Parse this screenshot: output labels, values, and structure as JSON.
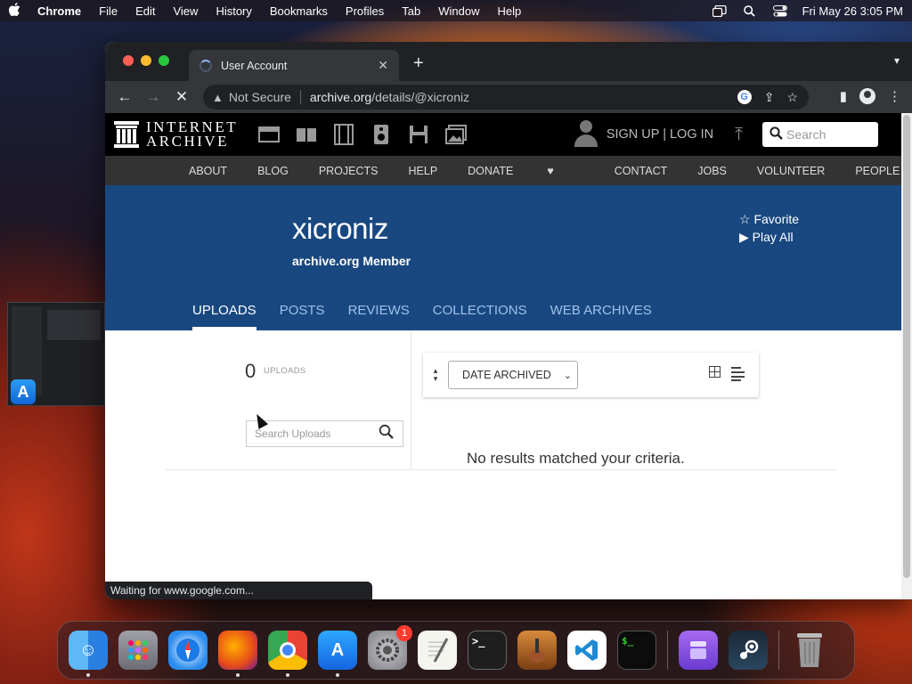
{
  "menubar": {
    "app": "Chrome",
    "items": [
      "File",
      "Edit",
      "View",
      "History",
      "Bookmarks",
      "Profiles",
      "Tab",
      "Window",
      "Help"
    ],
    "datetime": "Fri May 26  3:05 PM"
  },
  "browser": {
    "tab_title": "User Account",
    "security_label": "Not Secure",
    "url_host": "archive.org",
    "url_path": "/details/@xicroniz",
    "status_text": "Waiting for www.google.com..."
  },
  "ia": {
    "logo_line1": "INTERNET",
    "logo_line2": "ARCHIVE",
    "signin": "SIGN UP | LOG IN",
    "search_placeholder": "Search",
    "nav": [
      "ABOUT",
      "BLOG",
      "PROJECTS",
      "HELP",
      "DONATE",
      "CONTACT",
      "JOBS",
      "VOLUNTEER",
      "PEOPLE"
    ]
  },
  "profile": {
    "username": "xicroniz",
    "member_label": "archive.org Member",
    "favorite_label": "Favorite",
    "playall_label": "Play All",
    "tabs": [
      "UPLOADS",
      "POSTS",
      "REVIEWS",
      "COLLECTIONS",
      "WEB ARCHIVES"
    ]
  },
  "uploads": {
    "count": "0",
    "count_label": "UPLOADS",
    "search_placeholder": "Search Uploads",
    "sort_value": "DATE ARCHIVED",
    "no_results": "No results matched your criteria."
  },
  "dock": {
    "settings_badge": "1"
  },
  "colors": {
    "ia_banner": "#194880",
    "ia_nav": "#333333",
    "chrome_toolbar": "#35363a"
  }
}
